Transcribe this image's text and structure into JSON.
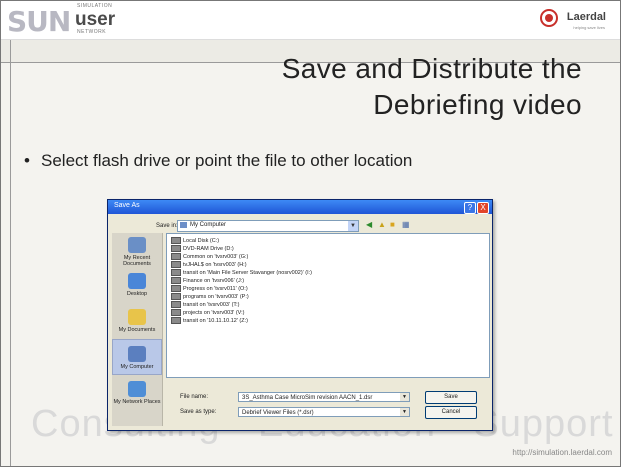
{
  "header": {
    "logo_sun": "SUN",
    "logo_user": "user",
    "logo_simulation": "SIMULATION",
    "logo_network": "NETWORK",
    "brand": "Laerdal",
    "brand_tagline": "helping save lives"
  },
  "slide": {
    "title_line1": "Save and Distribute the",
    "title_line2": "Debriefing video",
    "bullet": "Select flash drive or point the file to other location",
    "watermark": "Consulting  •  Education  •  Support",
    "url": "http://simulation.laerdal.com"
  },
  "dialog": {
    "title": "Save As",
    "help_label": "?",
    "close_label": "X",
    "save_in_label": "Save in:",
    "save_in_value": "My Computer",
    "places": [
      {
        "label": "My Recent Documents",
        "icon": "recent-documents-icon",
        "color": "#6a8fc6"
      },
      {
        "label": "Desktop",
        "icon": "desktop-icon",
        "color": "#4a86d8"
      },
      {
        "label": "My Documents",
        "icon": "my-documents-icon",
        "color": "#e8c44a"
      },
      {
        "label": "My Computer",
        "icon": "my-computer-icon",
        "color": "#5b7fbf"
      },
      {
        "label": "My Network Places",
        "icon": "network-places-icon",
        "color": "#4f8ed6"
      }
    ],
    "files": [
      "Local Disk (C:)",
      "DVD-RAM Drive (D:)",
      "Common on 'tvsrv003' (G:)",
      "tvJHAL$ on 'tvsrv003' (H:)",
      "transit on 'Main File Server Stavanger (nosrv002)' (I:)",
      "Finance on 'tvsrv006' (J:)",
      "Progress on 'tvsrv011' (O:)",
      "programs on 'tvsrv003' (P:)",
      "transit on 'tvsrv003' (T:)",
      "projects on 'tvsrv003' (V:)",
      "transit on '10.11.10.12' (Z:)"
    ],
    "file_name_label": "File name:",
    "file_name_value": "3S_Asthma Case MicroSim revision AACN_1.dsr",
    "save_as_type_label": "Save as type:",
    "save_as_type_value": "Debrief Viewer Files (*.dsr)",
    "save_button": "Save",
    "cancel_button": "Cancel"
  }
}
